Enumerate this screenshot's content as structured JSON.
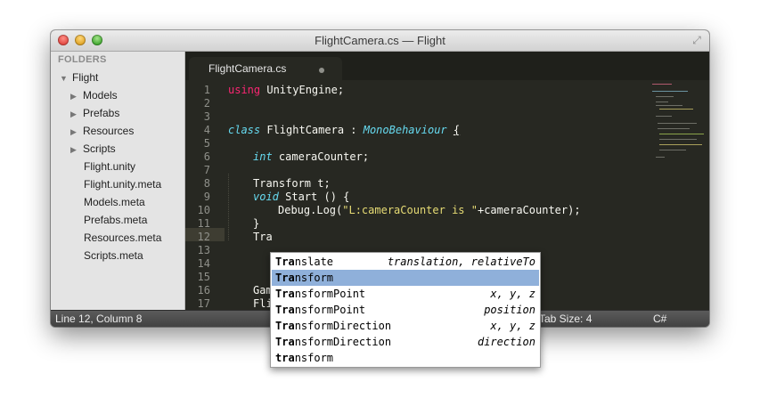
{
  "window": {
    "title": "FlightCamera.cs — Flight",
    "fullscreen_icon": "fullscreen-arrows-icon"
  },
  "sidebar": {
    "header": "FOLDERS",
    "root": "Flight",
    "folders": [
      "Models",
      "Prefabs",
      "Resources",
      "Scripts"
    ],
    "files": [
      "Flight.unity",
      "Flight.unity.meta",
      "Models.meta",
      "Prefabs.meta",
      "Resources.meta",
      "Scripts.meta"
    ]
  },
  "tabs": [
    {
      "label": "FlightCamera.cs",
      "modified": true
    }
  ],
  "editor": {
    "current_line": 12,
    "line_numbers": [
      "1",
      "2",
      "3",
      "4",
      "5",
      "6",
      "7",
      "8",
      "9",
      "10",
      "11",
      "12",
      "13",
      "14",
      "15",
      "16",
      "17"
    ],
    "lines": {
      "l1_kw": "using",
      "l1_rest": " UnityEngine;",
      "l4_kw": "class",
      "l4_name": " FlightCamera",
      "l4_colon": " : ",
      "l4_base": "MonoBehaviour",
      "l4_sp": " ",
      "l4_brace": "{",
      "l6_kw": "int",
      "l6_rest": " cameraCounter;",
      "l8": "Transform t;",
      "l9_kw": "void",
      "l9_name": " Start",
      "l9_rest": " () {",
      "l10_pre": "Debug.Log(",
      "l10_str": "\"L:cameraCounter is \"",
      "l10_post": "+cameraCounter);",
      "l11": "}",
      "l12": "Tra",
      "l16": "Gam",
      "l17": "Fli"
    }
  },
  "autocomplete": {
    "selected_index": 1,
    "items": [
      {
        "match": "Tra",
        "rest": "nslate",
        "hint": "translation, relativeTo"
      },
      {
        "match": "Tra",
        "rest": "nsform",
        "hint": ""
      },
      {
        "match": "Tra",
        "rest": "nsformPoint",
        "hint": "x, y, z"
      },
      {
        "match": "Tra",
        "rest": "nsformPoint",
        "hint": "position"
      },
      {
        "match": "Tra",
        "rest": "nsformDirection",
        "hint": "x, y, z"
      },
      {
        "match": "Tra",
        "rest": "nsformDirection",
        "hint": "direction"
      },
      {
        "match": "tra",
        "rest": "nsform",
        "hint": ""
      }
    ]
  },
  "status": {
    "position": "Line 12, Column 8",
    "tab_size": "Tab Size: 4",
    "syntax": "C#"
  },
  "colors": {
    "keyword": "#f92672",
    "storage_type": "#66d9ef",
    "class_name": "#a6e22e",
    "string": "#e6db74",
    "background": "#272822",
    "selection": "#8fb0da"
  }
}
